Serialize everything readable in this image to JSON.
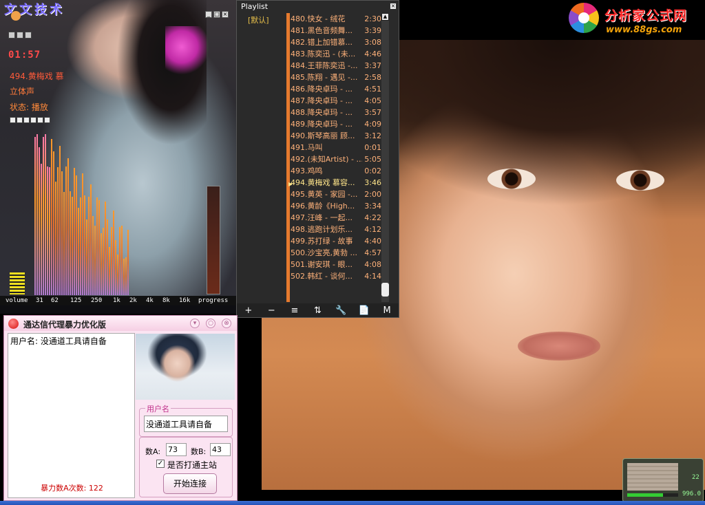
{
  "brand": {
    "title": "分析家公式网",
    "url": "www.88gs.com"
  },
  "player": {
    "logo": "文文技术",
    "clock": "01:57",
    "song": "494.黄梅戏 慕",
    "mode": "立体声",
    "state": "状态: 播放",
    "eq_labels": [
      "volume",
      "31",
      "62",
      "125",
      "250",
      "1k",
      "2k",
      "4k",
      "8k",
      "16k",
      "progress"
    ],
    "window_buttons": [
      "_",
      "□",
      "×"
    ]
  },
  "playlist": {
    "title": "Playlist",
    "group": "[默认]",
    "rows": [
      {
        "title": "480.快女 - 绒花",
        "dur": "2:30"
      },
      {
        "title": "481.黑色音频舞...",
        "dur": "3:39"
      },
      {
        "title": "482.错上加错慕...",
        "dur": "3:08"
      },
      {
        "title": "483.陈奕迅 - (未...",
        "dur": "4:46"
      },
      {
        "title": "484.王菲陈奕迅 -...",
        "dur": "3:37"
      },
      {
        "title": "485.陈翔 - 遇见 -...",
        "dur": "2:58"
      },
      {
        "title": "486.降央卓玛 - ...",
        "dur": "4:51"
      },
      {
        "title": "487.降央卓玛 - ...",
        "dur": "4:05"
      },
      {
        "title": "488.降央卓玛 - ...",
        "dur": "3:57"
      },
      {
        "title": "489.降央卓玛 - ...",
        "dur": "4:09"
      },
      {
        "title": "490.斯琴高丽 顾...",
        "dur": "3:12"
      },
      {
        "title": "491.马叫",
        "dur": "0:01"
      },
      {
        "title": "492.(未知Artist) - ...",
        "dur": "5:05"
      },
      {
        "title": "493.鸡鸣",
        "dur": "0:02"
      },
      {
        "title": "494.黄梅戏 慕容...",
        "dur": "3:46",
        "active": true
      },
      {
        "title": "495.黄英 - 家园 -...",
        "dur": "2:00"
      },
      {
        "title": "496.黄龄《High...",
        "dur": "3:34"
      },
      {
        "title": "497.汪峰 - 一起...",
        "dur": "4:22"
      },
      {
        "title": "498.逃跑计划乐...",
        "dur": "4:12"
      },
      {
        "title": "499.苏打绿 - 故事",
        "dur": "4:40"
      },
      {
        "title": "500.沙宝亮,黄勃 ...",
        "dur": "4:57"
      },
      {
        "title": "501.谢安琪 - 眼...",
        "dur": "4:08"
      },
      {
        "title": "502.韩红 - 谈何...",
        "dur": "4:14"
      }
    ],
    "toolbar": [
      "+",
      "−",
      "≡",
      "⇅",
      "🔧",
      "📄",
      "M"
    ]
  },
  "proxy": {
    "title": "通达信代理暴力优化版",
    "log_line": "用户名: 没通道工具请自备",
    "count_label": "暴力数A次数: 122",
    "username_legend": "用户名",
    "username_value": "没通道工具请自备",
    "a_label": "数A:",
    "a_value": "73",
    "b_label": "数B:",
    "b_value": "43",
    "checkbox_label": "是否打通主站",
    "checkbox_checked": true,
    "start_button": "开始连接"
  },
  "widget": {
    "num1": "22",
    "num2": "996.0"
  }
}
